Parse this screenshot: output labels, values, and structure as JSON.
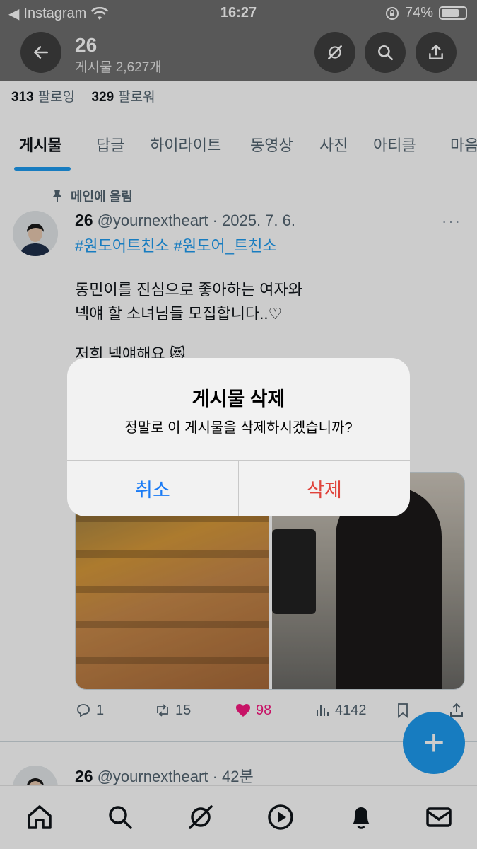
{
  "status_bar": {
    "back_app": "Instagram",
    "time": "16:27",
    "battery_percent": "74%",
    "battery_level": 0.74
  },
  "header": {
    "title": "26",
    "subtitle": "게시물 2,627개"
  },
  "profile": {
    "following_count": "313",
    "following_label": "팔로잉",
    "followers_count": "329",
    "followers_label": "팔로워"
  },
  "tabs": [
    {
      "label": "게시물",
      "active": true
    },
    {
      "label": "답글"
    },
    {
      "label": "하이라이트"
    },
    {
      "label": "동영상"
    },
    {
      "label": "사진"
    },
    {
      "label": "아티클"
    },
    {
      "label": "마음"
    }
  ],
  "post1": {
    "pinned_label": "메인에 올림",
    "name": "26",
    "handle_date": "@yournextheart · 2025. 7. 6.",
    "hashtags": "#원도어트친소 #원도어_트친소",
    "line1": "동민이를 진심으로 좋아하는 여자와",
    "line2": "넥얘 할 소녀님들 모집합니다..♡",
    "line3": "저희 넥얘해요 😻",
    "more": "···",
    "replies": "1",
    "reposts": "15",
    "likes": "98",
    "views": "4142"
  },
  "post2": {
    "name": "26",
    "handle_date": "@yournextheart · 42분"
  },
  "fab_label": "+",
  "alert": {
    "title": "게시물 삭제",
    "message": "정말로 이 게시물을 삭제하시겠습니까?",
    "cancel": "취소",
    "delete": "삭제"
  },
  "colors": {
    "accent": "#1d9bf0",
    "like": "#f91880",
    "destructive": "#e0433b",
    "ios_blue": "#1a7bf5"
  },
  "icons": [
    "back-arrow-icon",
    "grok-icon",
    "search-icon",
    "share-icon",
    "pin-icon",
    "reply-icon",
    "repost-icon",
    "heart-icon",
    "views-icon",
    "bookmark-icon",
    "home-icon",
    "spaces-icon",
    "play-icon",
    "bell-icon",
    "mail-icon"
  ]
}
